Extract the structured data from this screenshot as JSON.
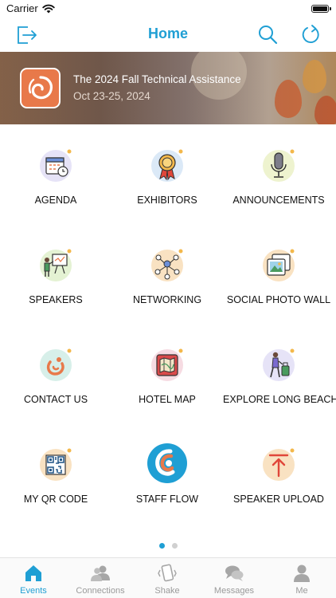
{
  "status_bar": {
    "carrier": "Carrier"
  },
  "nav": {
    "title": "Home"
  },
  "banner": {
    "title": "The 2024 Fall Technical Assistance",
    "date": "Oct 23-25, 2024"
  },
  "tiles": [
    {
      "label": "AGENDA",
      "icon": "calendar-clock-icon"
    },
    {
      "label": "EXHIBITORS",
      "icon": "award-ribbon-icon"
    },
    {
      "label": "ANNOUNCEMENTS",
      "icon": "microphone-icon"
    },
    {
      "label": "SPEAKERS",
      "icon": "presenter-board-icon"
    },
    {
      "label": "NETWORKING",
      "icon": "network-people-icon"
    },
    {
      "label": "SOCIAL PHOTO WALL",
      "icon": "photo-stack-icon"
    },
    {
      "label": "CONTACT US",
      "icon": "contact-logo-icon"
    },
    {
      "label": "HOTEL MAP",
      "icon": "map-icon"
    },
    {
      "label": "EXPLORE LONG BEACH",
      "icon": "traveler-luggage-icon"
    },
    {
      "label": "MY QR CODE",
      "icon": "qr-code-icon"
    },
    {
      "label": "STAFF FLOW",
      "icon": "staff-flow-logo-icon"
    },
    {
      "label": "SPEAKER UPLOAD",
      "icon": "upload-arrow-icon"
    }
  ],
  "pager": {
    "pages": 2,
    "current": 1
  },
  "tabs": [
    {
      "label": "Events",
      "icon": "home-icon",
      "active": true
    },
    {
      "label": "Connections",
      "icon": "people-icon",
      "active": false
    },
    {
      "label": "Shake",
      "icon": "shake-phone-icon",
      "active": false
    },
    {
      "label": "Messages",
      "icon": "chat-bubbles-icon",
      "active": false
    },
    {
      "label": "Me",
      "icon": "person-icon",
      "active": false
    }
  ],
  "colors": {
    "accent": "#1f9fd4",
    "brand_orange": "#e8794a",
    "inactive": "#9a9a9a"
  }
}
